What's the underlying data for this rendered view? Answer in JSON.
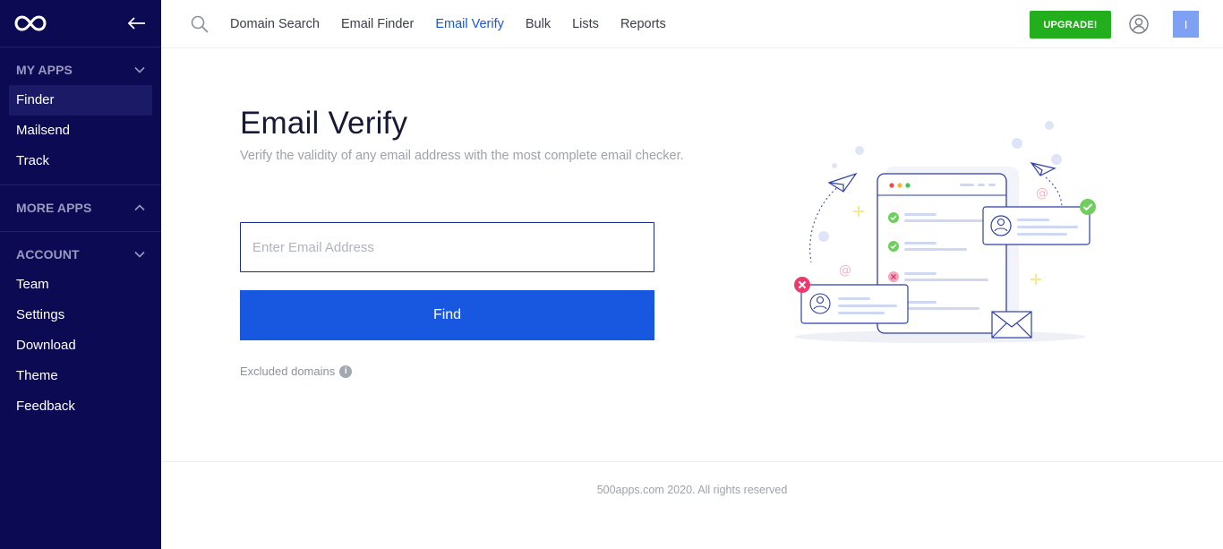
{
  "sidebar": {
    "sections": [
      {
        "title": "MY APPS",
        "expanded": true,
        "items": [
          "Finder",
          "Mailsend",
          "Track"
        ],
        "active": "Finder"
      },
      {
        "title": "MORE APPS",
        "expanded": false,
        "items": []
      },
      {
        "title": "ACCOUNT",
        "expanded": true,
        "items": [
          "Team",
          "Settings",
          "Download",
          "Theme",
          "Feedback"
        ]
      }
    ]
  },
  "topnav": {
    "links": [
      "Domain Search",
      "Email Finder",
      "Email Verify",
      "Bulk",
      "Lists",
      "Reports"
    ],
    "active": "Email Verify",
    "upgrade_label": "UPGRADE!",
    "avatar_initial": "I"
  },
  "main": {
    "title": "Email Verify",
    "subtitle": "Verify the validity of any email address with the most complete email checker.",
    "email_input": {
      "value": "",
      "placeholder": "Enter Email Address"
    },
    "find_label": "Find",
    "excluded_label": "Excluded domains",
    "info_glyph": "i"
  },
  "footer": {
    "text": "500apps.com 2020. All rights reserved"
  },
  "colors": {
    "sidebar_bg": "#0b0a52",
    "accent": "#1857e0",
    "upgrade": "#22ae1d",
    "avatar": "#7ea1f3"
  },
  "icons": [
    "infinity-logo-icon",
    "arrow-left-icon",
    "chevron-down-icon",
    "chevron-up-icon",
    "search-icon",
    "user-circle-icon",
    "info-icon"
  ]
}
